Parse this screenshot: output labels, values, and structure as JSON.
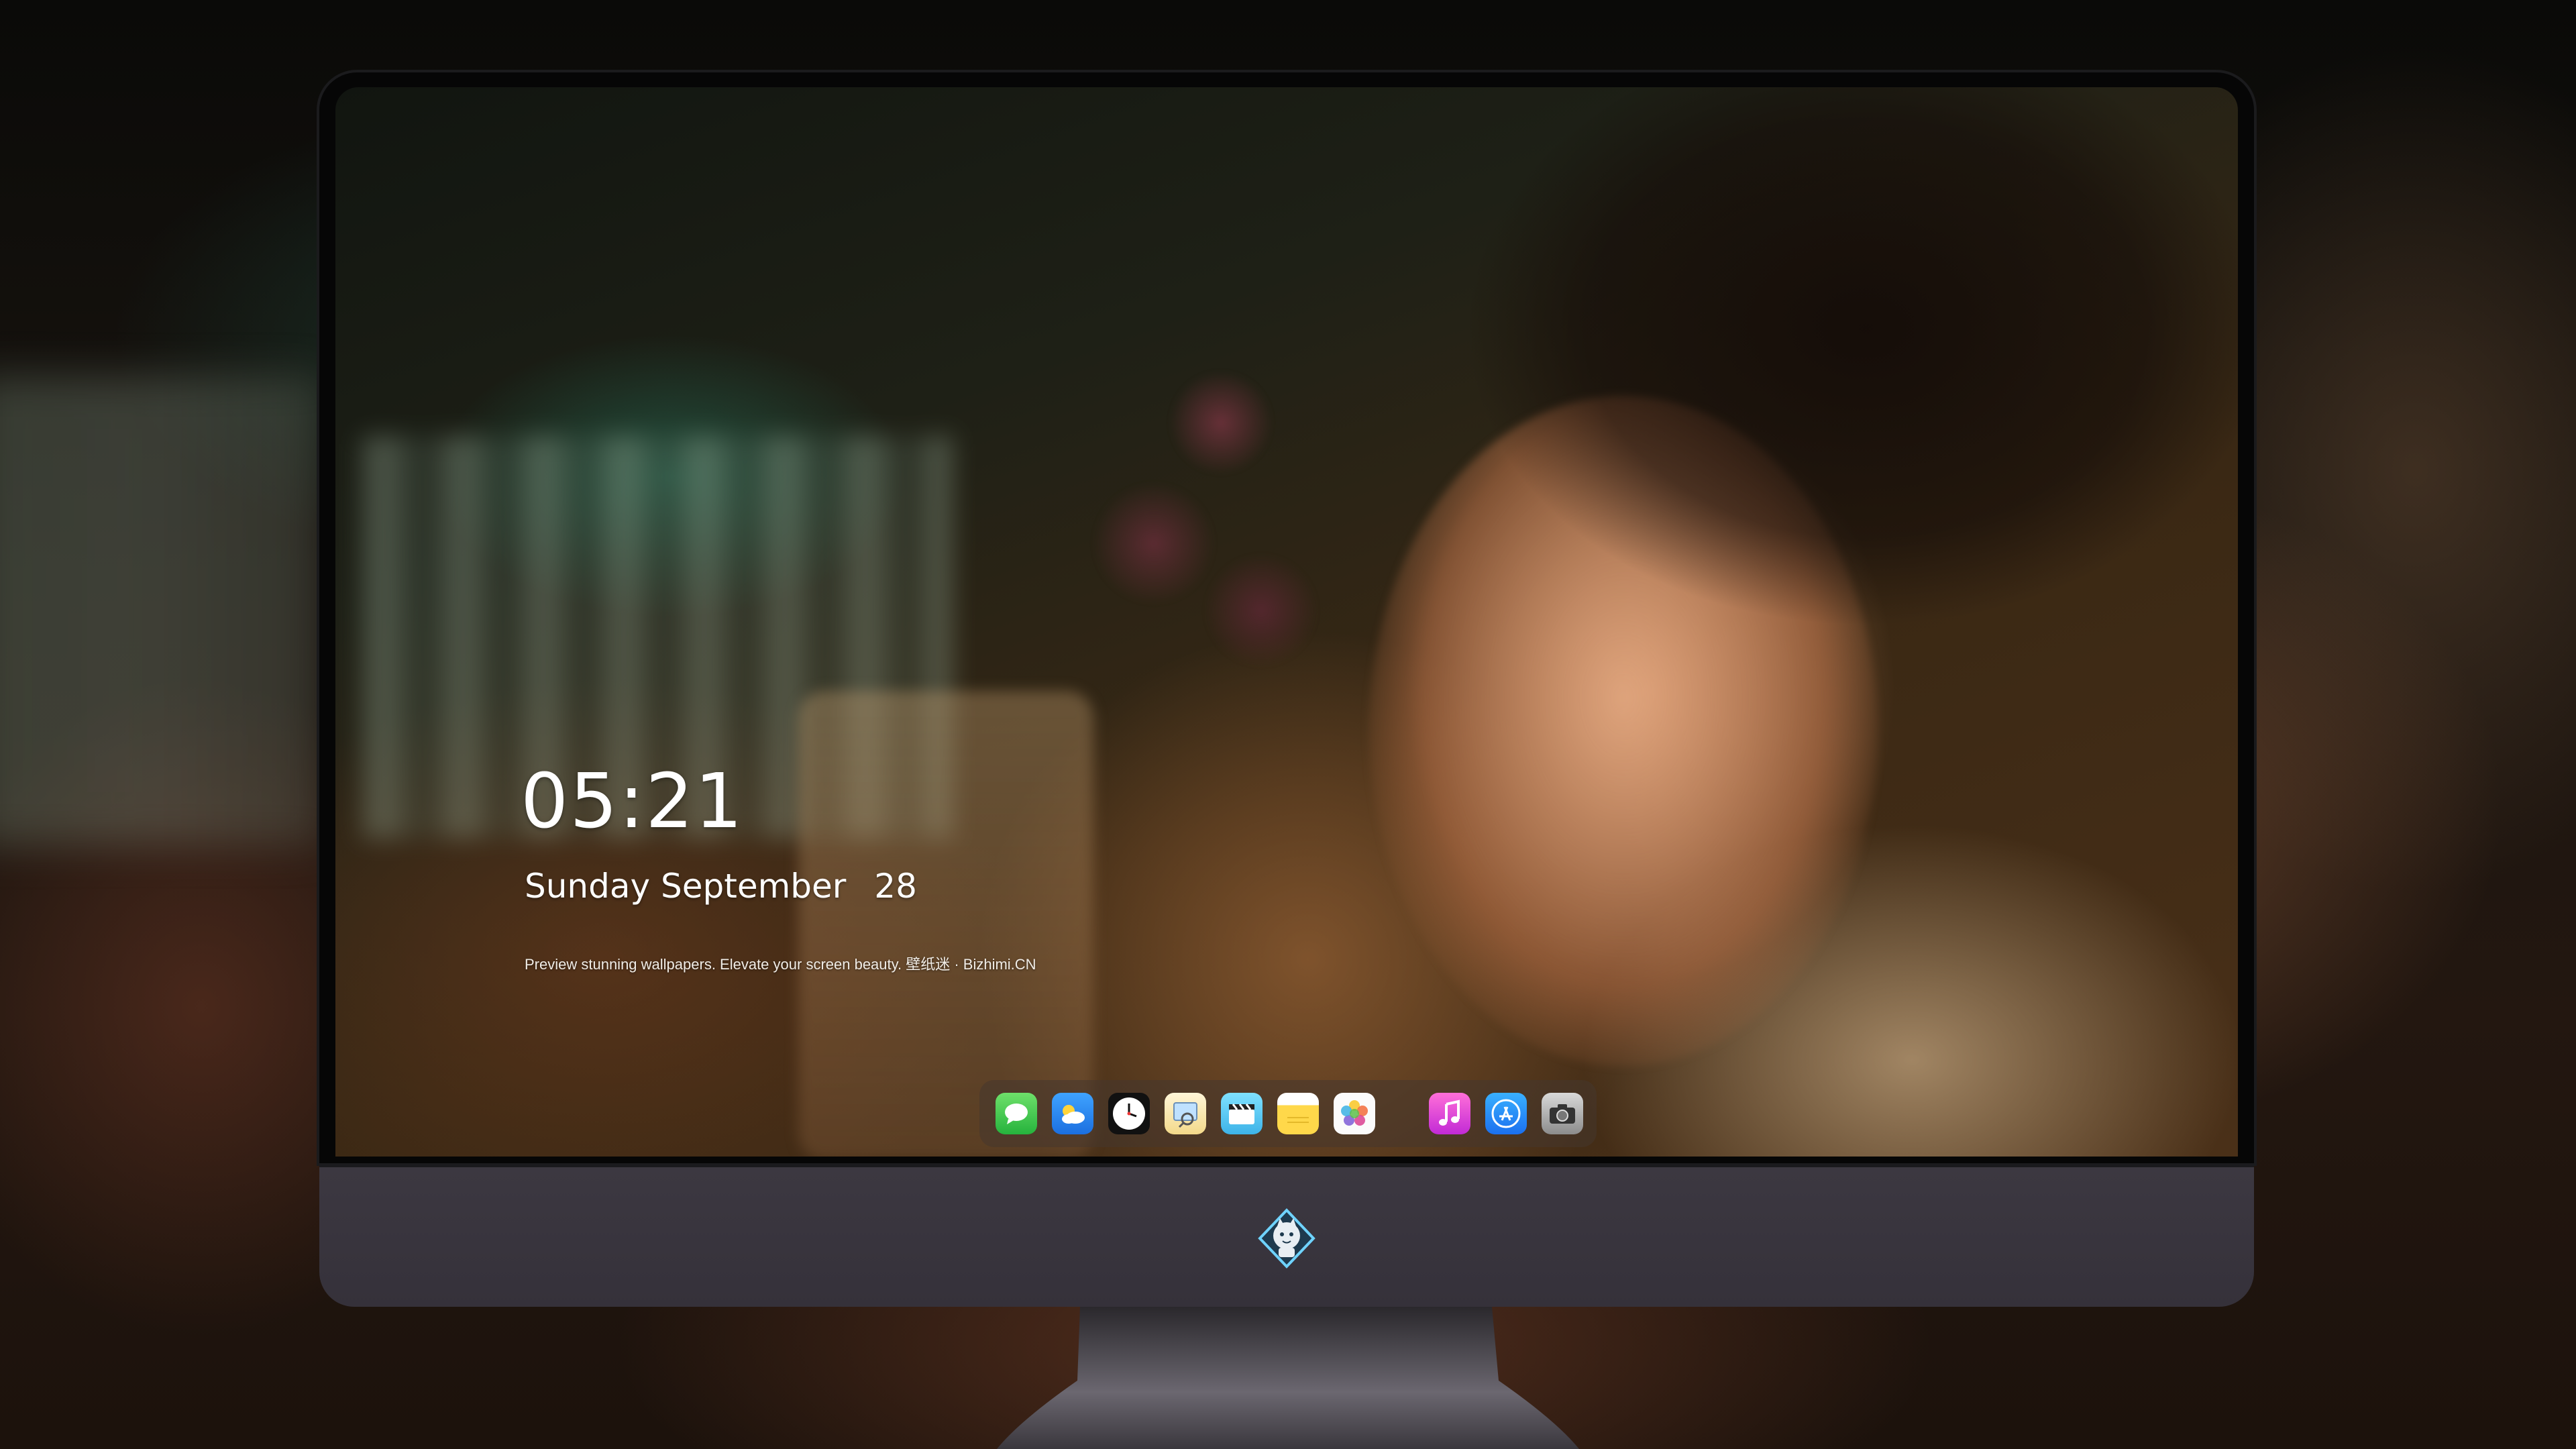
{
  "lockscreen": {
    "time": "05:21",
    "weekday": "Sunday",
    "month": "September",
    "day": "28",
    "tagline": "Preview stunning wallpapers. Elevate your screen beauty. 壁纸迷 · Bizhimi.CN"
  },
  "dock": {
    "apps": [
      {
        "name": "messages",
        "icon": "messages-icon"
      },
      {
        "name": "weather",
        "icon": "weather-icon"
      },
      {
        "name": "clock",
        "icon": "clock-icon"
      },
      {
        "name": "preview",
        "icon": "preview-icon"
      },
      {
        "name": "clips",
        "icon": "clapperboard-icon"
      },
      {
        "name": "notes",
        "icon": "notes-icon"
      },
      {
        "name": "photos",
        "icon": "photos-icon"
      },
      {
        "name": "music",
        "icon": "music-note-icon"
      },
      {
        "name": "app-store",
        "icon": "app-store-icon"
      },
      {
        "name": "camera",
        "icon": "camera-icon"
      }
    ]
  },
  "colors": {
    "chin": "#3c3841",
    "bezel": "#060606",
    "text": "#ffffff"
  }
}
